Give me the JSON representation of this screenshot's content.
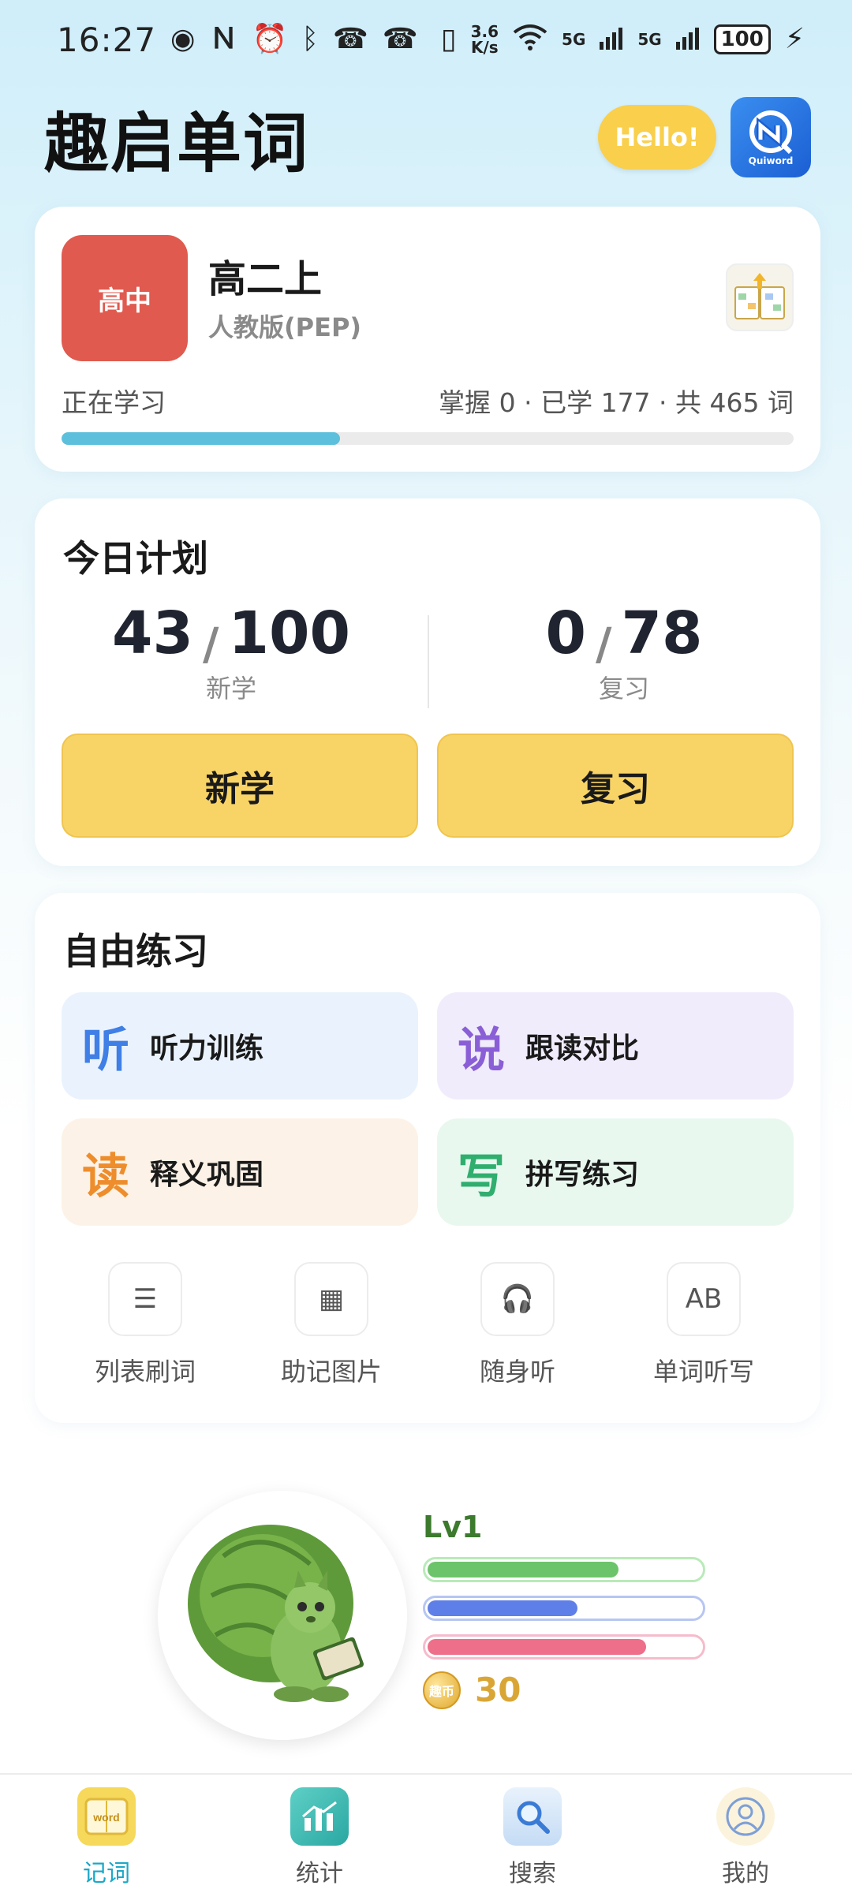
{
  "status_bar": {
    "time": "16:27",
    "net_speed_top": "3.6",
    "net_speed_bottom": "K/s",
    "signal1": "5G",
    "signal2": "5G",
    "battery": "100"
  },
  "header": {
    "title": "趣启单词",
    "hello_button": "Hello!",
    "logo_text": "Quiword"
  },
  "book": {
    "level_badge": "高中",
    "title": "高二上",
    "edition": "人教版(PEP)",
    "studying_label": "正在学习",
    "progress_text": "掌握 0 · 已学 177 · 共 465 词",
    "learned": 177,
    "total": 465,
    "progress_fraction": 0.38
  },
  "plan": {
    "title": "今日计划",
    "new": {
      "done": "43",
      "target": "100",
      "caption": "新学"
    },
    "review": {
      "done": "0",
      "target": "78",
      "caption": "复习"
    },
    "slash": "/",
    "new_button": "新学",
    "review_button": "复习"
  },
  "practice": {
    "title": "自由练习",
    "tiles": [
      {
        "glyph": "听",
        "label": "听力训练",
        "glyph_color": "#3f7fe6",
        "bg": "#eaf3fd"
      },
      {
        "glyph": "说",
        "label": "跟读对比",
        "glyph_color": "#8a5fd6",
        "bg": "#f1ecfc"
      },
      {
        "glyph": "读",
        "label": "释义巩固",
        "glyph_color": "#ee8d2c",
        "bg": "#fdf2e7"
      },
      {
        "glyph": "写",
        "label": "拼写练习",
        "glyph_color": "#2fae6e",
        "bg": "#e8f8ef"
      }
    ],
    "tools": [
      {
        "icon": "☰",
        "label": "列表刷词"
      },
      {
        "icon": "▦",
        "label": "助记图片"
      },
      {
        "icon": "🎧",
        "label": "随身听"
      },
      {
        "icon": "AB",
        "label": "单词听写"
      }
    ]
  },
  "mascot": {
    "level": "Lv1",
    "bars": [
      {
        "fraction": 0.7,
        "fill": "#6cc46a",
        "border": "#b9eab8"
      },
      {
        "fraction": 0.55,
        "fill": "#5f7fe8",
        "border": "#b7c6f2"
      },
      {
        "fraction": 0.8,
        "fill": "#ee6f89",
        "border": "#f5bccb"
      }
    ],
    "coin_label": "趣币",
    "coins": "30"
  },
  "nav": {
    "items": [
      {
        "label": "记词",
        "icon": "word-book-icon",
        "active": true
      },
      {
        "label": "统计",
        "icon": "stats-icon",
        "active": false
      },
      {
        "label": "搜索",
        "icon": "search-icon",
        "active": false
      },
      {
        "label": "我的",
        "icon": "profile-icon",
        "active": false
      }
    ],
    "word_icon_text": "word"
  },
  "colors": {
    "accent_cyan": "#5cc0dc",
    "button_yellow": "#f8d466",
    "badge_red": "#e05a4f"
  }
}
